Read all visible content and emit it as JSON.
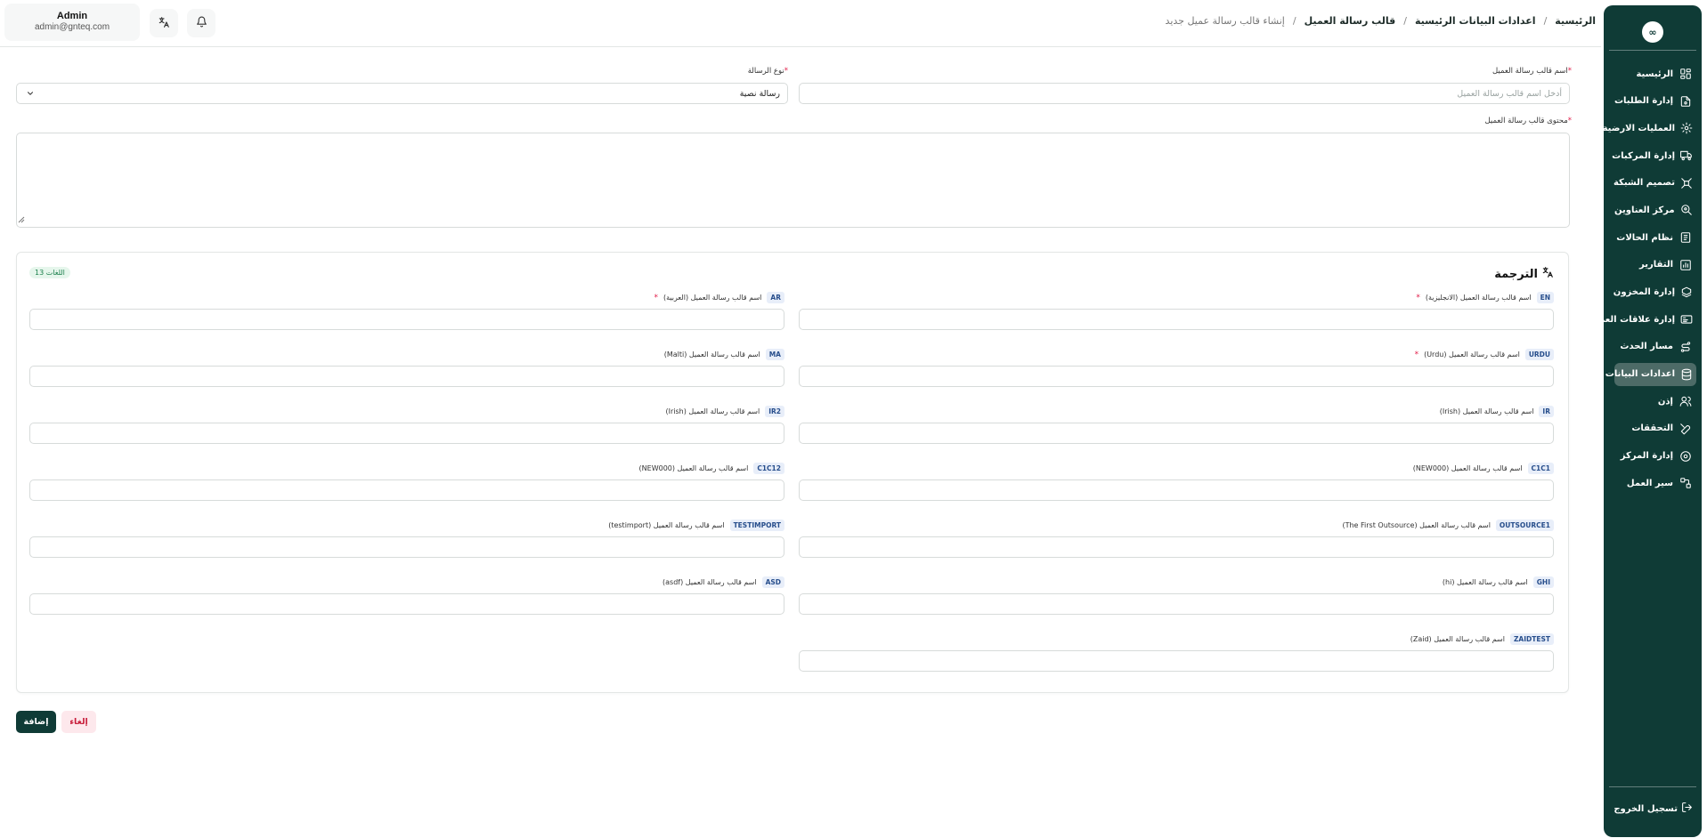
{
  "sidebar": {
    "logo": "∞",
    "items": [
      {
        "label": "الرئيسية",
        "icon": "dashboard-icon",
        "active": false
      },
      {
        "label": "إدارة الطلبات",
        "icon": "orders-icon",
        "active": false
      },
      {
        "label": "العمليات الارضية",
        "icon": "ground-ops-icon",
        "active": false
      },
      {
        "label": "إدارة المركبات",
        "icon": "truck-icon",
        "active": false
      },
      {
        "label": "تصميم الشبكة",
        "icon": "network-icon",
        "active": false
      },
      {
        "label": "مركز العناوين",
        "icon": "address-icon",
        "active": false
      },
      {
        "label": "نظام الحالات",
        "icon": "status-icon",
        "active": false
      },
      {
        "label": "التقارير",
        "icon": "reports-icon",
        "active": false
      },
      {
        "label": "إدارة المخزون",
        "icon": "inventory-icon",
        "active": false
      },
      {
        "label": "إدارة علاقات العملاء",
        "icon": "crm-icon",
        "active": false
      },
      {
        "label": "مسار الحدث",
        "icon": "route-icon",
        "active": false
      },
      {
        "label": "اعدادات البيانات",
        "icon": "database-icon",
        "active": true
      },
      {
        "label": "إذن",
        "icon": "users-icon",
        "active": false
      },
      {
        "label": "التحققات",
        "icon": "tools-icon",
        "active": false
      },
      {
        "label": "إدارة المركز",
        "icon": "center-icon",
        "active": false
      },
      {
        "label": "سير العمل",
        "icon": "workflow-icon",
        "active": false
      }
    ],
    "logout": "تسجيل الخروج"
  },
  "header": {
    "user_name": "Admin",
    "user_email": "admin@gnteq.com",
    "breadcrumb": [
      {
        "label": "الرئيسية",
        "current": false
      },
      {
        "label": "اعدادات البيانات الرئيسية",
        "current": false
      },
      {
        "label": "قالب رسالة العميل",
        "current": false
      },
      {
        "label": "إنشاء قالب رسالة عميل جديد",
        "current": true
      }
    ]
  },
  "form": {
    "name_label": "اسم قالب رسالة العميل",
    "name_placeholder": "أدخل اسم قالب رسالة العميل",
    "type_label": "نوع الرسالة",
    "type_value": "رسالة نصية",
    "content_label": "محتوى قالب رسالة العميل"
  },
  "translation": {
    "title": "الترجمة",
    "count_badge": "13 اللغات",
    "rows": [
      {
        "code": "EN",
        "label": "اسم قالب رسالة العميل (الانجليزية)",
        "required": true
      },
      {
        "code": "AR",
        "label": "اسم قالب رسالة العميل (العربية)",
        "required": true
      },
      {
        "code": "URDU",
        "label": "اسم قالب رسالة العميل (Urdu)",
        "required": true
      },
      {
        "code": "MA",
        "label": "اسم قالب رسالة العميل (Malti)",
        "required": false
      },
      {
        "code": "IR",
        "label": "اسم قالب رسالة العميل (Irish)",
        "required": false
      },
      {
        "code": "IR2",
        "label": "اسم قالب رسالة العميل (Irish)",
        "required": false
      },
      {
        "code": "C1C1",
        "label": "اسم قالب رسالة العميل (NEW000)",
        "required": false
      },
      {
        "code": "C1C12",
        "label": "اسم قالب رسالة العميل (NEW000)",
        "required": false
      },
      {
        "code": "OUTSOURCE1",
        "label": "اسم قالب رسالة العميل (The First Outsource)",
        "required": false
      },
      {
        "code": "TESTIMPORT",
        "label": "اسم قالب رسالة العميل (testimport)",
        "required": false
      },
      {
        "code": "GHI",
        "label": "اسم قالب رسالة العميل (hi)",
        "required": false
      },
      {
        "code": "ASD",
        "label": "اسم قالب رسالة العميل (asdf)",
        "required": false
      },
      {
        "code": "ZAIDTEST",
        "label": "اسم قالب رسالة العميل (Zaid)",
        "required": false
      }
    ]
  },
  "actions": {
    "add": "إضافة",
    "cancel": "إلغاء"
  },
  "colors": {
    "primary": "#0f3b36",
    "danger": "#e11d48",
    "success_bg": "#e6f6ec"
  }
}
